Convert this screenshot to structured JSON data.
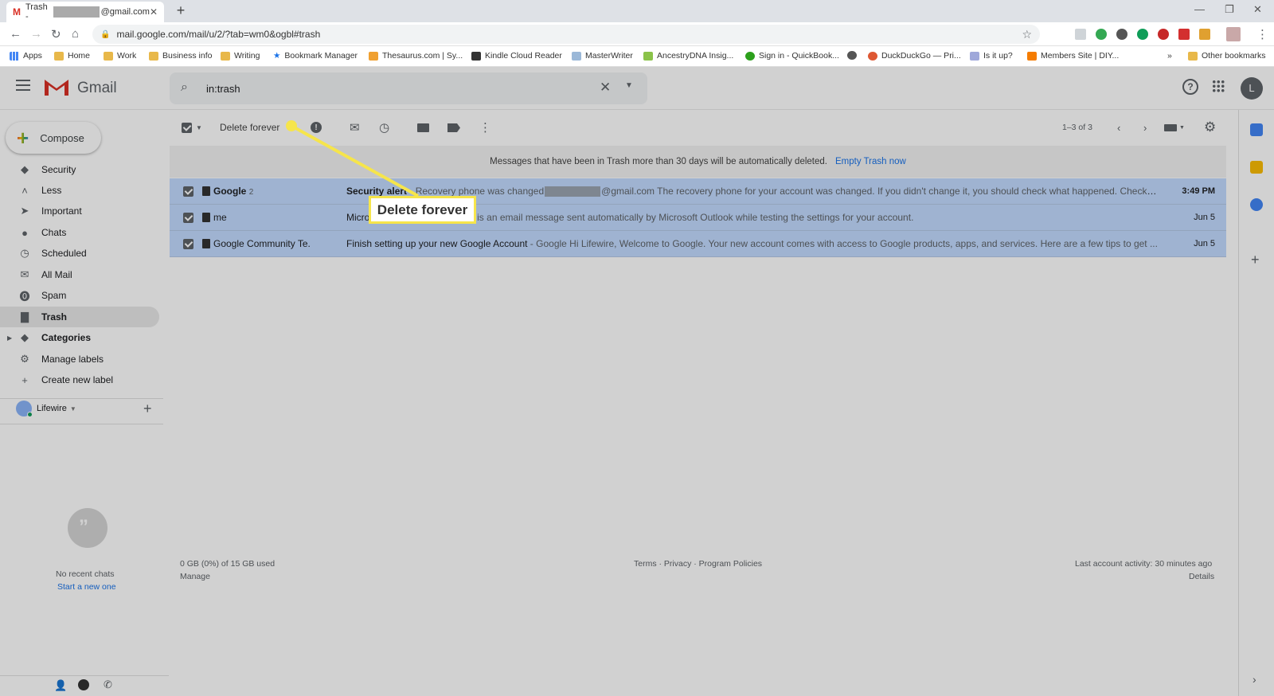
{
  "browser": {
    "tab_title_prefix": "Trash -",
    "tab_title_suffix": "@gmail.com",
    "url": "mail.google.com/mail/u/2/?tab=wm0&ogbl#trash",
    "bookmarks": [
      "Apps",
      "Home",
      "Work",
      "Business info",
      "Writing",
      "Bookmark Manager",
      "Thesaurus.com | Sy...",
      "Kindle Cloud Reader",
      "MasterWriter",
      "AncestryDNA Insig...",
      "Sign in - QuickBook...",
      "DuckDuckGo — Pri...",
      "Is it up?",
      "Members Site | DIY..."
    ],
    "more_bookmarks": "»",
    "other_bookmarks": "Other bookmarks"
  },
  "gmail": {
    "logo_text": "Gmail",
    "search_value": "in:trash",
    "avatar_letter": "L",
    "compose_label": "Compose"
  },
  "sidebar": {
    "items": [
      {
        "label": "Security",
        "icon": "label-icon"
      },
      {
        "label": "Less",
        "icon": "chevron-up-icon"
      },
      {
        "label": "Important",
        "icon": "important-icon"
      },
      {
        "label": "Chats",
        "icon": "chat-icon"
      },
      {
        "label": "Scheduled",
        "icon": "scheduled-icon"
      },
      {
        "label": "All Mail",
        "icon": "mail-icon"
      },
      {
        "label": "Spam",
        "icon": "spam-icon"
      },
      {
        "label": "Trash",
        "icon": "trash-icon"
      },
      {
        "label": "Categories",
        "icon": "category-icon"
      },
      {
        "label": "Manage labels",
        "icon": "gear-icon"
      },
      {
        "label": "Create new label",
        "icon": "plus-icon"
      }
    ],
    "hangouts_user": "Lifewire",
    "no_chats": "No recent chats",
    "start_new": "Start a new one"
  },
  "toolbar": {
    "delete_forever": "Delete forever",
    "pagination": "1–3 of 3"
  },
  "banner": {
    "text": "Messages that have been in Trash more than 30 days will be automatically deleted.",
    "link": "Empty Trash now"
  },
  "messages": [
    {
      "sender": "Google",
      "count": "2",
      "subject": "Security alert",
      "snippet": " - Recovery phone was changed",
      "snippet2": "@gmail.com The recovery phone for your account was changed. If you didn't change it, you should check what happened. Check a...",
      "date": "3:49 PM",
      "unread": true
    },
    {
      "sender": "me",
      "count": "",
      "subject": "Micro",
      "snippet": "ge - This is an email message sent automatically by Microsoft Outlook while testing the settings for your account.",
      "snippet2": "",
      "date": "Jun 5",
      "unread": false
    },
    {
      "sender": "Google Community Te.",
      "count": "",
      "subject": "Finish setting up your new Google Account",
      "snippet": " - Google Hi Lifewire, Welcome to Google. Your new account comes with access to Google products, apps, and services. Here are a few tips to get ...",
      "snippet2": "",
      "date": "Jun 5",
      "unread": false
    }
  ],
  "footer": {
    "storage": "0 GB (0%) of 15 GB used",
    "manage": "Manage",
    "links": "Terms · Privacy · Program Policies",
    "activity": "Last account activity: 30 minutes ago",
    "details": "Details"
  },
  "callout": {
    "label": "Delete forever",
    "highlight_color": "#f6e54b"
  },
  "colors": {
    "selected_row": "#c2dbff",
    "gmail_red": "#d93025",
    "link_blue": "#1a73e8"
  }
}
